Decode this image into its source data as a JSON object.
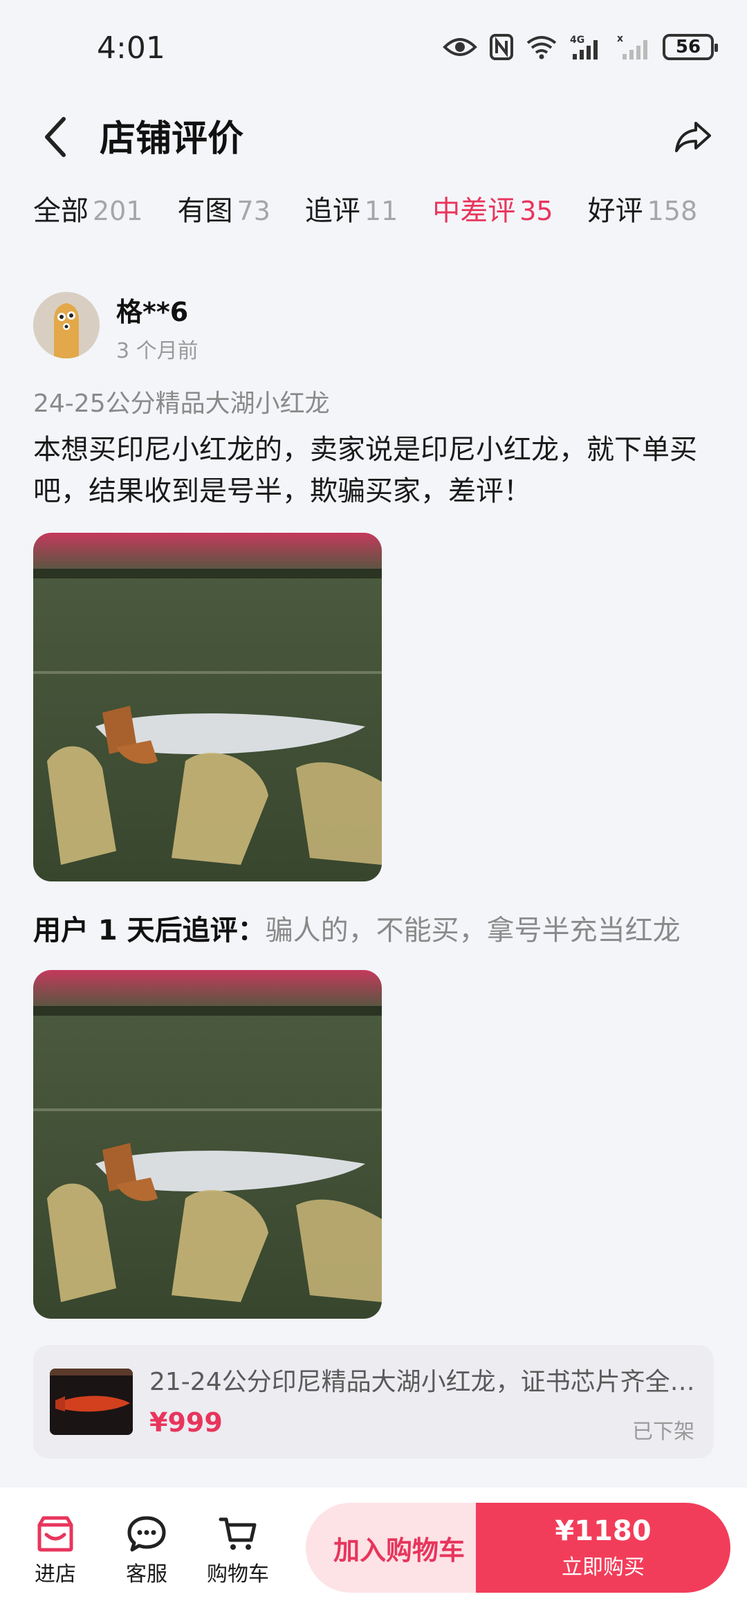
{
  "status_bar": {
    "time": "4:01",
    "battery": "56",
    "icons": [
      "eye-icon",
      "nfc-icon",
      "wifi-icon",
      "4g-signal-icon",
      "signal-icon",
      "battery-icon"
    ]
  },
  "header": {
    "title": "店铺评价",
    "back_icon": "chevron-left-icon",
    "share_icon": "share-icon"
  },
  "tabs": [
    {
      "label": "全部",
      "count": "201"
    },
    {
      "label": "有图",
      "count": "73"
    },
    {
      "label": "追评",
      "count": "11"
    },
    {
      "label": "中差评",
      "count": "35",
      "active": true
    },
    {
      "label": "好评",
      "count": "158"
    }
  ],
  "review": {
    "username": "格**6",
    "time_ago": "3 个月前",
    "sku": "24-25公分精品大湖小红龙",
    "content": "本想买印尼小红龙的，卖家说是印尼小红龙，就下单买吧，结果收到是号半，欺骗买家，差评！",
    "followup_label": "用户 1 天后追评：",
    "followup_text": "骗人的，不能买，拿号半充当红龙"
  },
  "product": {
    "name": "21-24公分印尼精品大湖小红龙，证书芯片齐全…",
    "price": "¥999",
    "status": "已下架"
  },
  "bottom_bar": {
    "store": "进店",
    "service": "客服",
    "cart": "购物车",
    "add_to_cart": "加入购物车",
    "buy_price": "¥1180",
    "buy_now": "立即购买"
  },
  "colors": {
    "accent": "#e8355c",
    "buy_button": "#f23d5a",
    "cart_button_bg": "#fde3e6",
    "page_bg": "#f4f5f9"
  }
}
